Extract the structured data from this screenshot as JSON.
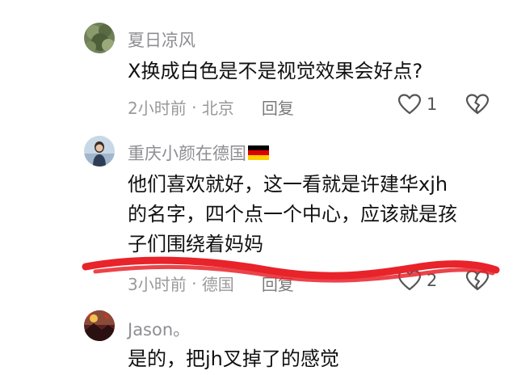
{
  "comments": [
    {
      "username": "夏日凉风",
      "text": "X换成白色是不是视觉效果会好点?",
      "time": "2小时前",
      "location": "北京",
      "reply_label": "回复",
      "likes": "1"
    },
    {
      "username": "重庆小颜在德国",
      "text_lines": [
        "他们喜欢就好，这一看就是许建华xjh",
        "的名字，四个点一个中心，应该就是孩",
        "子们围绕着妈妈"
      ],
      "time": "3小时前",
      "location": "德国",
      "reply_label": "回复",
      "likes": "2"
    },
    {
      "username": "Jason。",
      "text": "是的，把jh叉掉了的感觉"
    }
  ],
  "icons": {
    "like": "heart-outline-icon",
    "dislike": "broken-heart-icon",
    "flag": "germany-flag-icon"
  },
  "colors": {
    "annotation_stroke": "#e8232a",
    "secondary_text": "#999999",
    "username_text": "#8e8e93"
  }
}
